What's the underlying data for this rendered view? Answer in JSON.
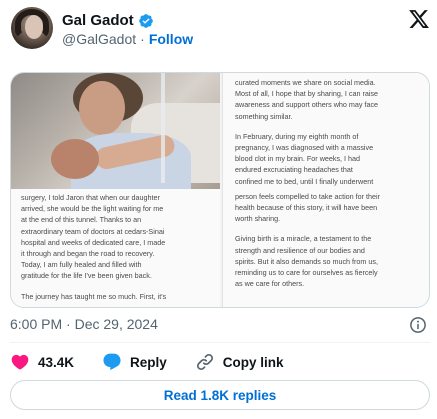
{
  "author": {
    "display_name": "Gal Gadot",
    "handle": "@GalGadot",
    "separator": "·",
    "follow_label": "Follow"
  },
  "media": {
    "left_text": [
      "surgery, I told Jaron that when our daughter",
      "arrived, she would be the light waiting for me",
      "at the end of this tunnel. Thanks to an",
      "extraordinary team of doctors at cedars-Sinai",
      "hospital and weeks of dedicated care, I made",
      "it through and began the road to recovery.",
      "Today, I am fully healed and filled with",
      "gratitude for the life I've been given back.",
      "The journey has taught me so much. First, it's"
    ],
    "right_text_p1": [
      "curated moments we share on social media.",
      "Most of all, I hope that by sharing, I can raise",
      "awareness and support others who may face",
      "something similar."
    ],
    "right_text_p2": [
      "In February, during my eighth month of",
      "pregnancy, I was diagnosed with a massive",
      "blood clot in my brain. For weeks, I had",
      "endured excruciating headaches that",
      "confined me to bed, until I finally underwent"
    ],
    "right_text_p3": [
      "person feels compelled to take action for their",
      "health because of this story, it will have been",
      "worth sharing."
    ],
    "right_text_p4": [
      "Giving birth is a miracle, a testament to the",
      "strength and resilience of our bodies and",
      "spirits. But it also demands so much from us,",
      "reminding us to care for ourselves as fiercely",
      "as we care for others."
    ]
  },
  "meta": {
    "time": "6:00 PM",
    "separator": "·",
    "date": "Dec 29, 2024"
  },
  "actions": {
    "likes": "43.4K",
    "reply_label": "Reply",
    "copy_link_label": "Copy link"
  },
  "read_replies_label": "Read 1.8K replies",
  "colors": {
    "brand_blue": "#1d9bf0",
    "link_blue": "#006fd6",
    "like_red": "#f91880",
    "muted": "#536471"
  },
  "icons": [
    "verified-badge-icon",
    "x-logo-icon",
    "info-icon",
    "heart-icon",
    "reply-bubble-icon",
    "link-icon"
  ]
}
